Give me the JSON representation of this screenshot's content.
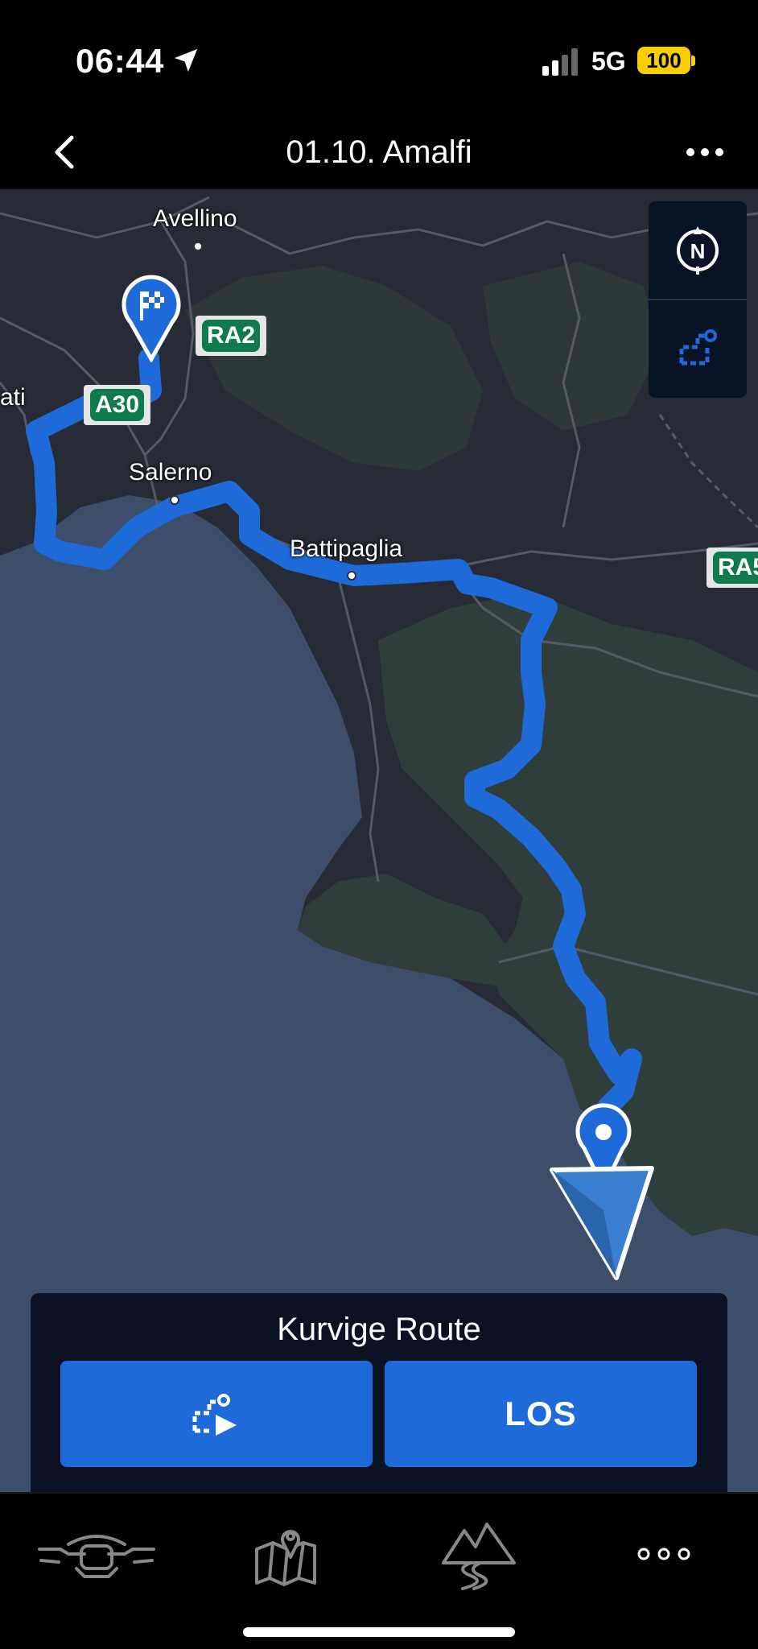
{
  "status": {
    "time": "06:44",
    "network": "5G",
    "battery": "100"
  },
  "header": {
    "title": "01.10. Amalfi"
  },
  "map": {
    "labels": {
      "avellino": "Avellino",
      "salerno": "Salerno",
      "battipaglia": "Battipaglia",
      "partial_left": "ati"
    },
    "shields": {
      "ra2": "RA2",
      "a30": "A30",
      "ra5": "RA5"
    }
  },
  "route_panel": {
    "title": "Kurvige Route",
    "go_label": "LOS"
  },
  "tabs": [
    {
      "icon": "motorcycle-icon"
    },
    {
      "icon": "map-pin-icon"
    },
    {
      "icon": "mountain-road-icon"
    },
    {
      "icon": "more-dots-icon"
    }
  ],
  "colors": {
    "route": "#1f6ad9",
    "accent": "#1f6ad9",
    "land": "#262b35",
    "water": "#3d4e6a",
    "forest": "#2f3e3a"
  }
}
